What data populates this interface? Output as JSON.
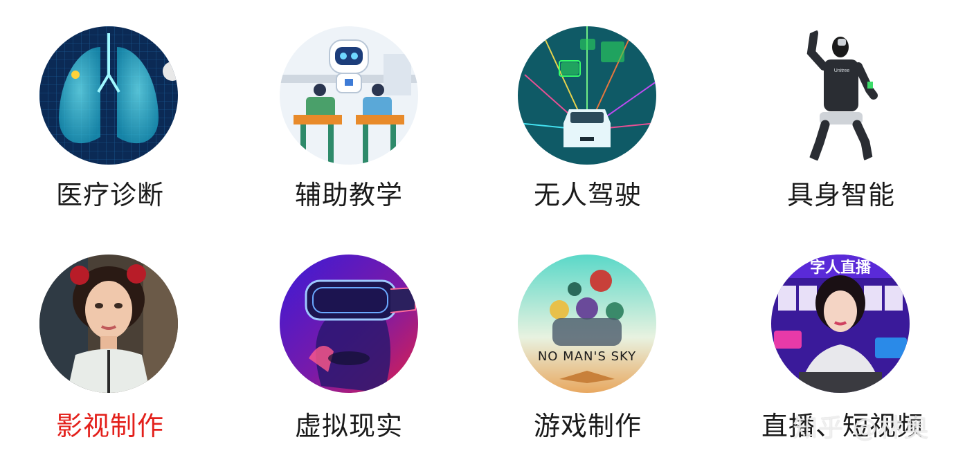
{
  "categories": [
    {
      "label": "医疗诊断",
      "icon": "lung-scan-icon",
      "selected": false
    },
    {
      "label": "辅助教学",
      "icon": "robot-teacher-icon",
      "selected": false
    },
    {
      "label": "无人驾驶",
      "icon": "self-driving-car-icon",
      "selected": false
    },
    {
      "label": "具身智能",
      "icon": "humanoid-robot-icon",
      "selected": false
    },
    {
      "label": "影视制作",
      "icon": "film-actress-icon",
      "selected": true
    },
    {
      "label": "虚拟现实",
      "icon": "vr-headset-icon",
      "selected": false
    },
    {
      "label": "游戏制作",
      "icon": "game-cover-icon",
      "selected": false
    },
    {
      "label": "直播、短视频",
      "icon": "live-stream-icon",
      "selected": false
    }
  ],
  "thumb_text": {
    "game_title": "NO MAN'S SKY",
    "robot_brand": "Unitree",
    "live_banner": "字人直播"
  },
  "watermark": "知乎 @林奥",
  "colors": {
    "selected": "#e3201b",
    "text": "#1a1a1a"
  }
}
